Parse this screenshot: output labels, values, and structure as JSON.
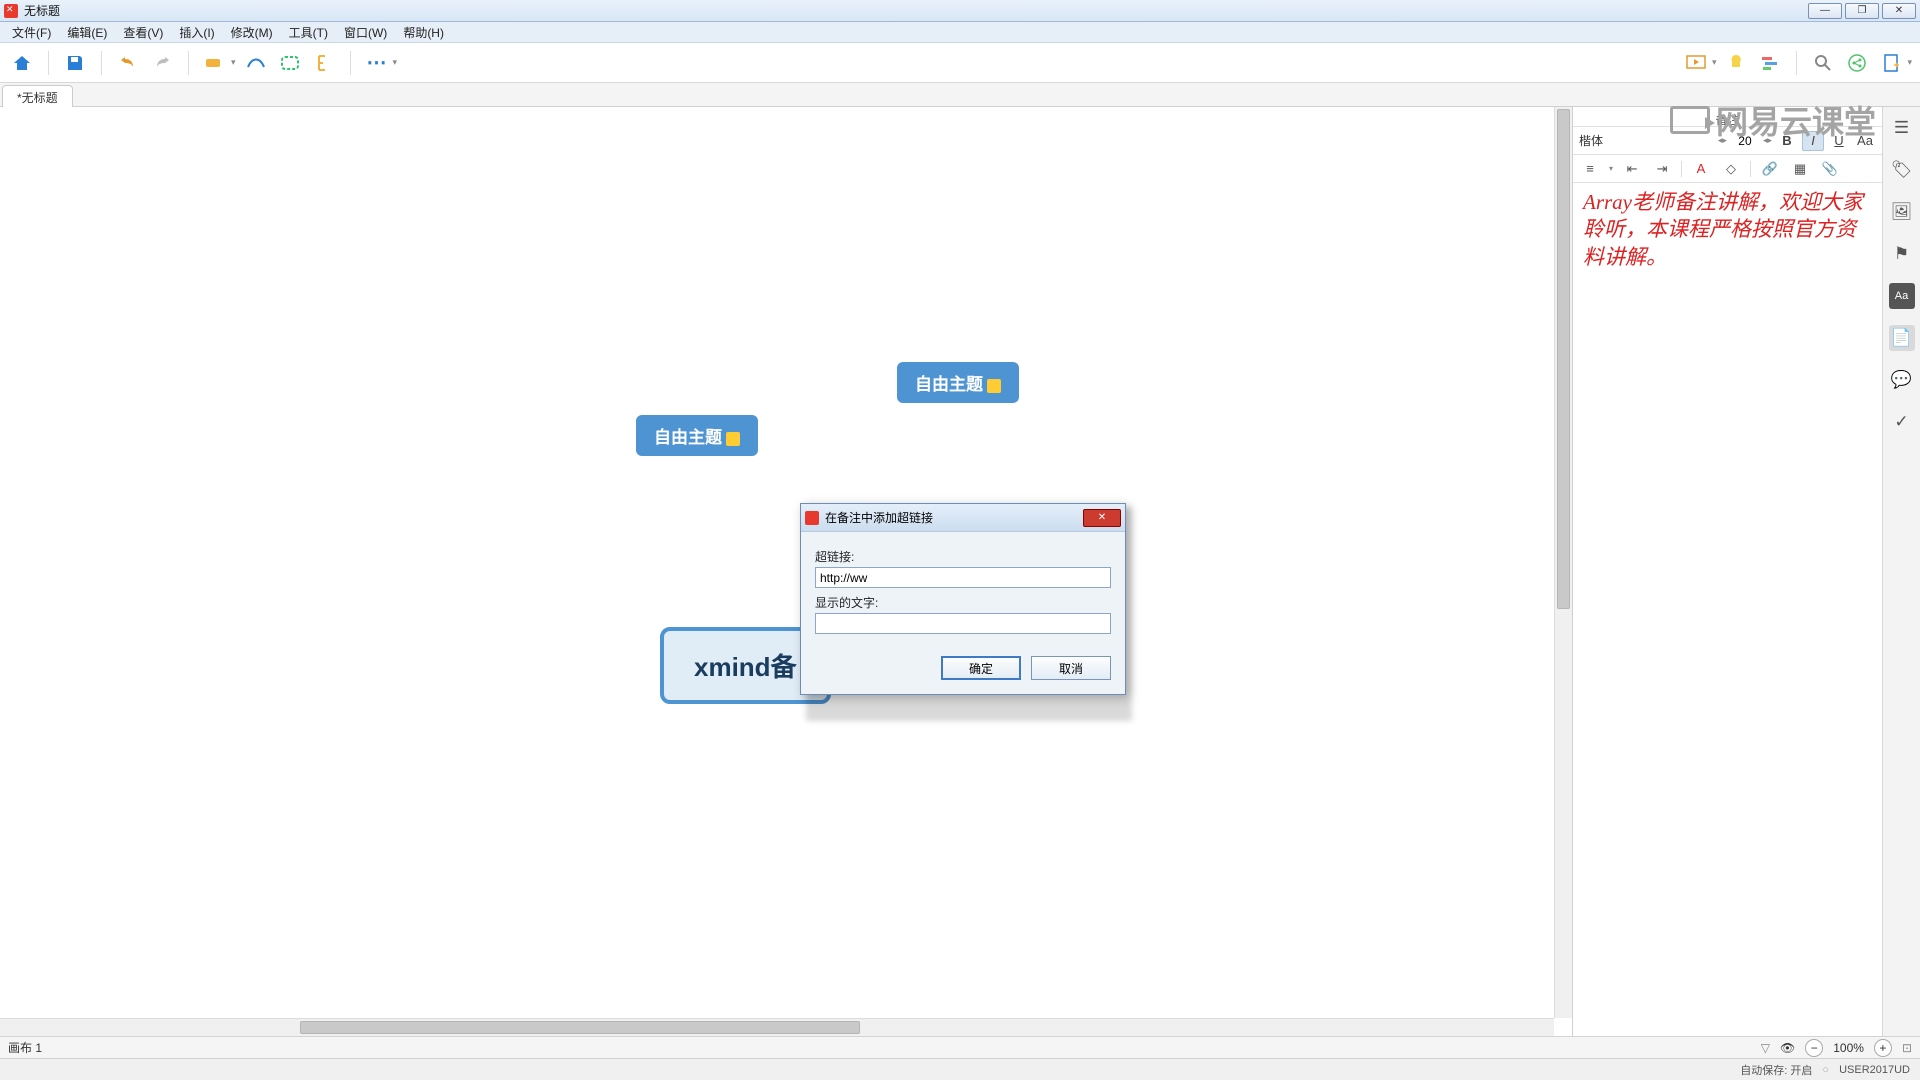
{
  "titlebar": {
    "title": "无标题"
  },
  "menu": {
    "file": "文件(F)",
    "edit": "编辑(E)",
    "view": "查看(V)",
    "insert": "插入(I)",
    "modify": "修改(M)",
    "tools": "工具(T)",
    "window": "窗口(W)",
    "help": "帮助(H)"
  },
  "tab": {
    "label": "*无标题"
  },
  "canvas": {
    "free1": "自由主题",
    "free2": "自由主题",
    "main": "xmind备"
  },
  "dialog": {
    "title": "在备注中添加超链接",
    "label_url": "超链接:",
    "url_value": "http://ww",
    "label_text": "显示的文字:",
    "text_value": "",
    "ok": "确定",
    "cancel": "取消"
  },
  "notes": {
    "header": "备注",
    "font": "楷体",
    "size": "20",
    "content": "Array老师备注讲解，欢迎大家聆听，本课程严格按照官方资料讲解。"
  },
  "watermark": "网易云课堂",
  "canvastab": {
    "label": "画布 1",
    "zoom": "100%"
  },
  "status": {
    "autosave": "自动保存: 开启",
    "user": "USER2017UD"
  }
}
